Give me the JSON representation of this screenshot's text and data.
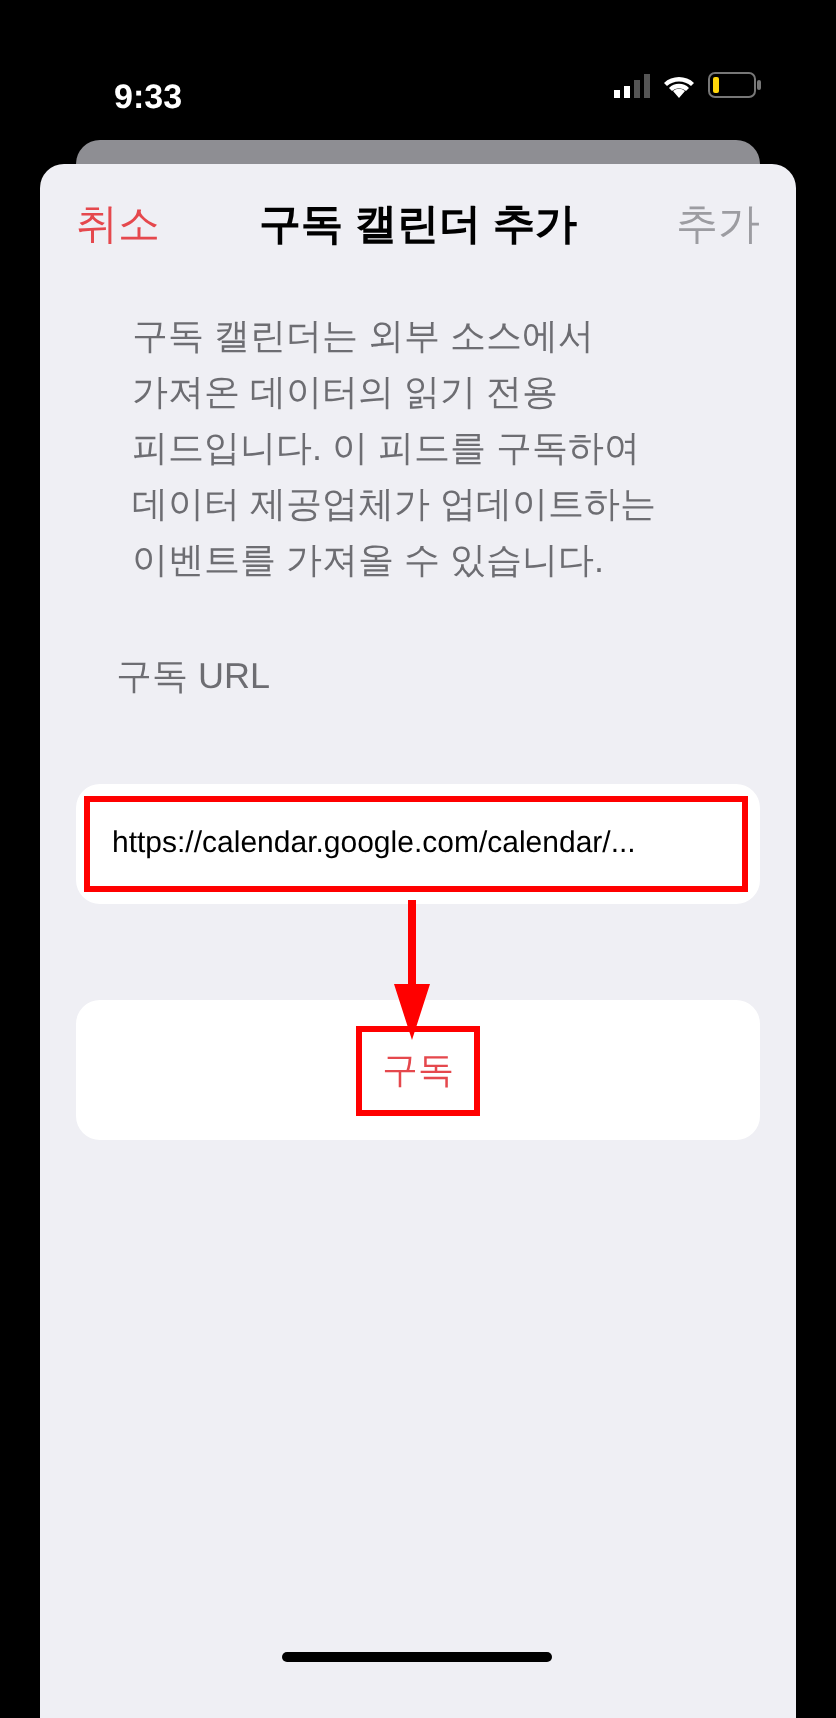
{
  "status_bar": {
    "time": "9:33"
  },
  "nav": {
    "cancel": "취소",
    "title": "구독 캘린더 추가",
    "add": {
      "label": "추가",
      "enabled": false
    }
  },
  "description": "구독 캘린더는 외부 소스에서 가져온 데이터의 읽기 전용 피드입니다. 이 피드를 구독하여 데이터 제공업체가 업데이트하는 이벤트를 가져올 수 있습니다.",
  "url_field": {
    "label": "구독 URL",
    "value": "https://calendar.google.com/calendar/...",
    "highlighted": true
  },
  "subscribe_button": {
    "label": "구독",
    "highlighted": true
  }
}
